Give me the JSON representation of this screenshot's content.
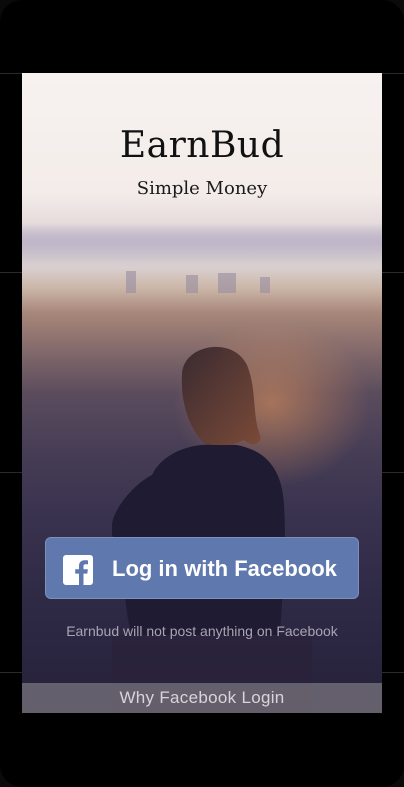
{
  "app": {
    "title": "EarnBud",
    "tagline": "Simple Money"
  },
  "login": {
    "button_label": "Log in with Facebook",
    "button_icon": "facebook-icon",
    "button_color": "#5f78ae",
    "disclaimer": "Earnbud will not post anything on Facebook"
  },
  "footer": {
    "why_link": "Why Facebook Login"
  }
}
